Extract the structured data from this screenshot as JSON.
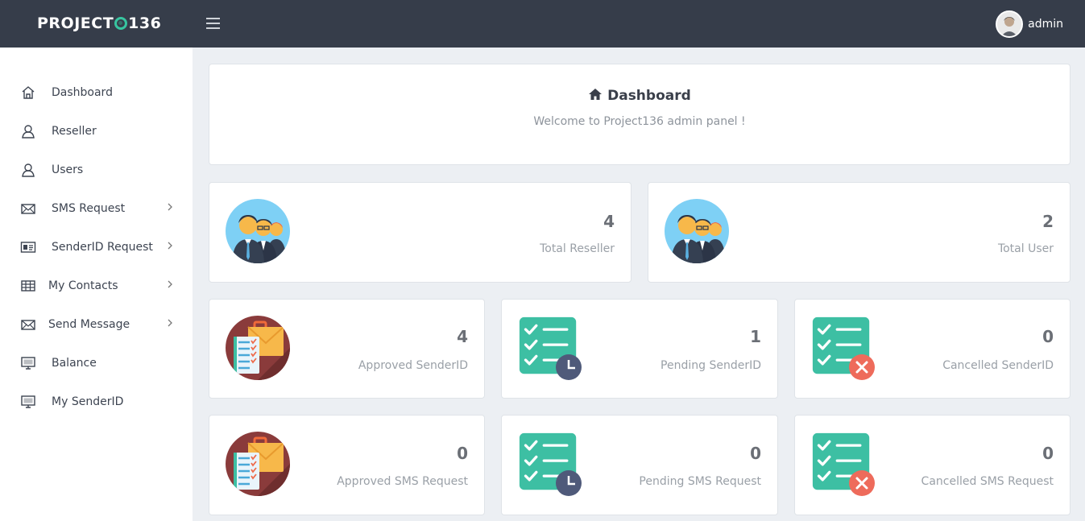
{
  "brand": {
    "name_prefix": "PROJECT",
    "name_suffix": "136"
  },
  "user": {
    "name": "admin"
  },
  "sidebar": {
    "items": [
      {
        "label": "Dashboard",
        "icon": "home-icon",
        "has_submenu": false
      },
      {
        "label": "Reseller",
        "icon": "user-icon",
        "has_submenu": false
      },
      {
        "label": "Users",
        "icon": "user-icon",
        "has_submenu": false
      },
      {
        "label": "SMS Request",
        "icon": "envelope-icon",
        "has_submenu": true
      },
      {
        "label": "SenderID Request",
        "icon": "id-card-icon",
        "has_submenu": true
      },
      {
        "label": "My Contacts",
        "icon": "table-icon",
        "has_submenu": true
      },
      {
        "label": "Send Message",
        "icon": "envelope-icon",
        "has_submenu": true
      },
      {
        "label": "Balance",
        "icon": "monitor-icon",
        "has_submenu": false
      },
      {
        "label": "My SenderID",
        "icon": "monitor-icon",
        "has_submenu": false
      }
    ]
  },
  "header": {
    "title": "Dashboard",
    "subtitle": "Welcome to Project136 admin panel !"
  },
  "stats": [
    {
      "value": "4",
      "label": "Total Reseller",
      "icon": "people-group-icon"
    },
    {
      "value": "2",
      "label": "Total User",
      "icon": "people-group-icon"
    },
    {
      "value": "4",
      "label": "Approved SenderID",
      "icon": "approved-clipboard-icon"
    },
    {
      "value": "1",
      "label": "Pending SenderID",
      "icon": "checklist-clock-icon"
    },
    {
      "value": "0",
      "label": "Cancelled SenderID",
      "icon": "checklist-cancel-icon"
    },
    {
      "value": "0",
      "label": "Approved SMS Request",
      "icon": "approved-clipboard-icon"
    },
    {
      "value": "0",
      "label": "Pending SMS Request",
      "icon": "checklist-clock-icon"
    },
    {
      "value": "0",
      "label": "Cancelled SMS Request",
      "icon": "checklist-cancel-icon"
    }
  ],
  "colors": {
    "topbar": "#363d4a",
    "accent": "#37c5a0",
    "teal_icon": "#3dbfa3",
    "cancel_red": "#ee6b5b",
    "clock_navy": "#4f5a7a",
    "maroon": "#8a3b3b"
  }
}
